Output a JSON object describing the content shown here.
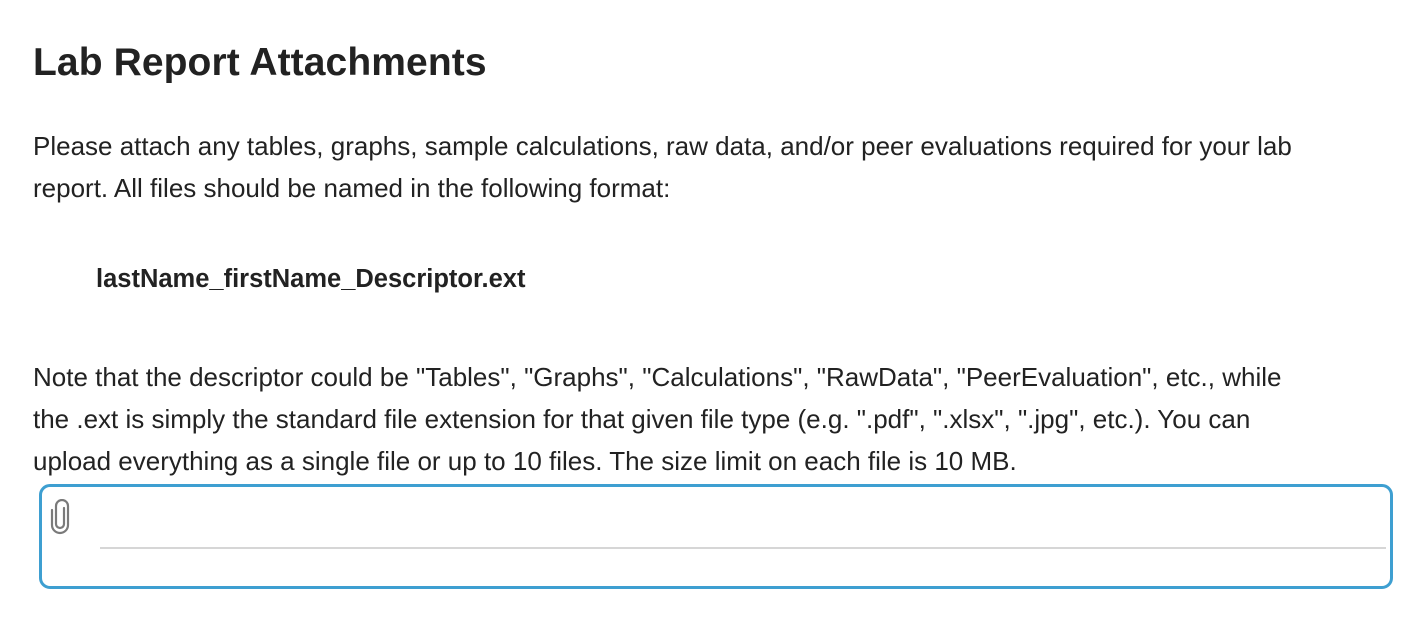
{
  "section": {
    "title": "Lab Report Attachments",
    "intro_lines": [
      "Please attach any tables, graphs, sample calculations, raw data, and/or peer evaluations required for your lab",
      "report. All files should be named in the following format:"
    ],
    "filename_format": "lastName_firstName_Descriptor.ext",
    "note_lines": [
      "Note that the descriptor could be \"Tables\", \"Graphs\", \"Calculations\", \"RawData\", \"PeerEvaluation\", etc., while",
      "the .ext is simply the standard file extension for that given file type (e.g. \".pdf\", \".xlsx\", \".jpg\", etc.). You can",
      "upload everything as a single file or up to 10 files. The size limit on each file is 10 MB."
    ]
  },
  "upload": {
    "icon": "paperclip-icon",
    "focus_color": "#3e9fd1",
    "value": ""
  }
}
